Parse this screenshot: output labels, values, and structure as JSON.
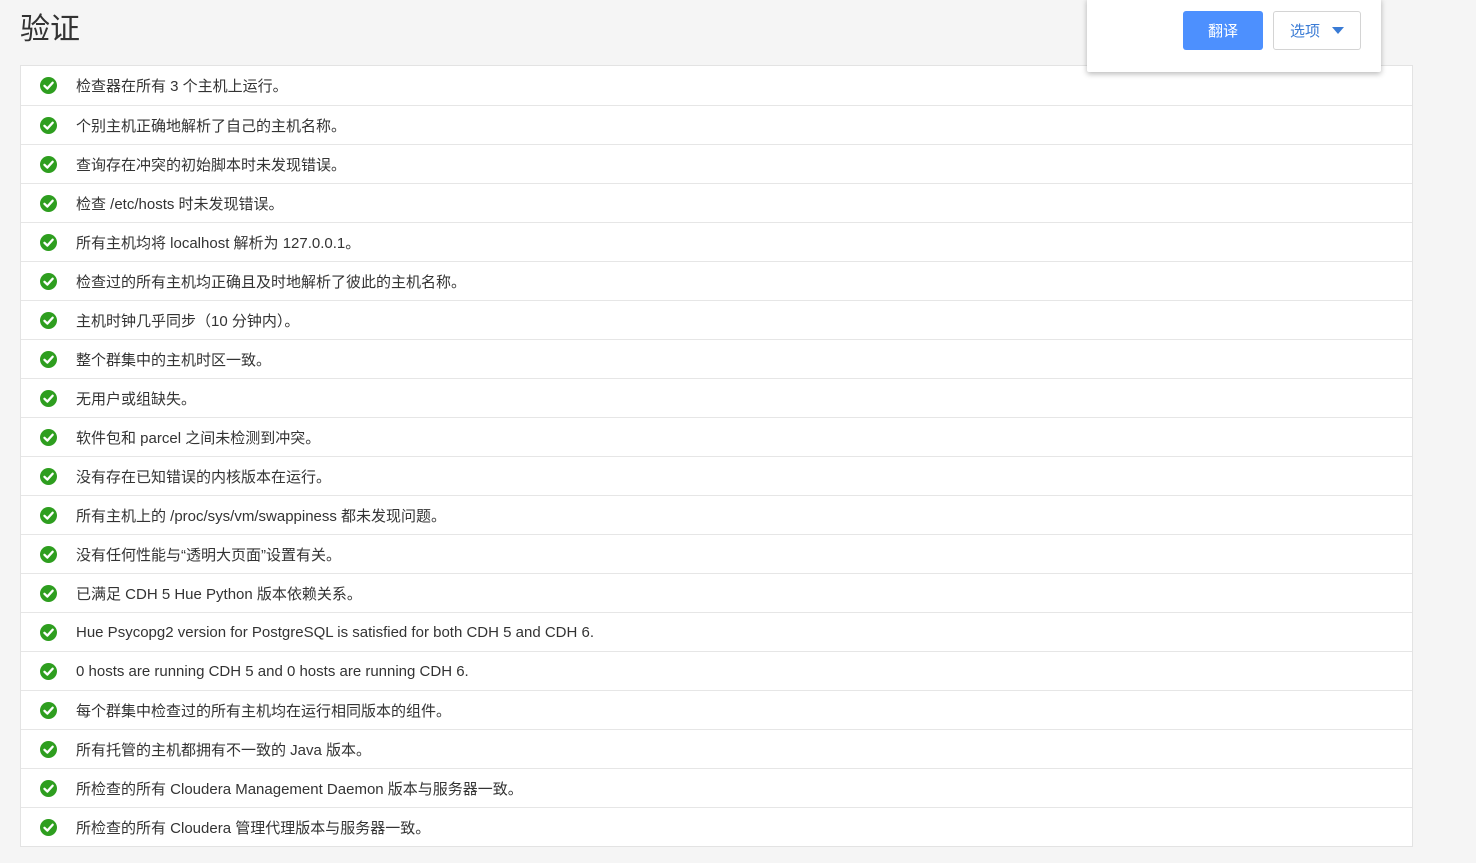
{
  "page": {
    "title": "验证"
  },
  "checks": [
    {
      "text": "检查器在所有 3 个主机上运行。"
    },
    {
      "text": "个别主机正确地解析了自己的主机名称。"
    },
    {
      "text": "查询存在冲突的初始脚本时未发现错误。"
    },
    {
      "text": "检查 /etc/hosts 时未发现错误。"
    },
    {
      "text": "所有主机均将 localhost 解析为 127.0.0.1。"
    },
    {
      "text": "检查过的所有主机均正确且及时地解析了彼此的主机名称。"
    },
    {
      "text": "主机时钟几乎同步（10 分钟内）。"
    },
    {
      "text": "整个群集中的主机时区一致。"
    },
    {
      "text": "无用户或组缺失。"
    },
    {
      "text": "软件包和 parcel 之间未检测到冲突。"
    },
    {
      "text": "没有存在已知错误的内核版本在运行。"
    },
    {
      "text": "所有主机上的 /proc/sys/vm/swappiness 都未发现问题。"
    },
    {
      "text": "没有任何性能与“透明大页面”设置有关。"
    },
    {
      "text": "已满足 CDH 5 Hue Python 版本依赖关系。"
    },
    {
      "text": "Hue Psycopg2 version for PostgreSQL is satisfied for both CDH 5 and CDH 6."
    },
    {
      "text": "0 hosts are running CDH 5 and 0 hosts are running CDH 6."
    },
    {
      "text": "每个群集中检查过的所有主机均在运行相同版本的组件。"
    },
    {
      "text": "所有托管的主机都拥有不一致的 Java 版本。"
    },
    {
      "text": "所检查的所有 Cloudera Management Daemon 版本与服务器一致。"
    },
    {
      "text": "所检查的所有 Cloudera 管理代理版本与服务器一致。"
    }
  ],
  "translate_popup": {
    "translate_label": "翻译",
    "options_label": "选项"
  },
  "icons": {
    "check": "check-circle-icon",
    "options_caret": "caret-down-icon"
  },
  "colors": {
    "success": "#2e9e1f",
    "primary": "#4d90fe",
    "link": "#3a7bd5"
  }
}
